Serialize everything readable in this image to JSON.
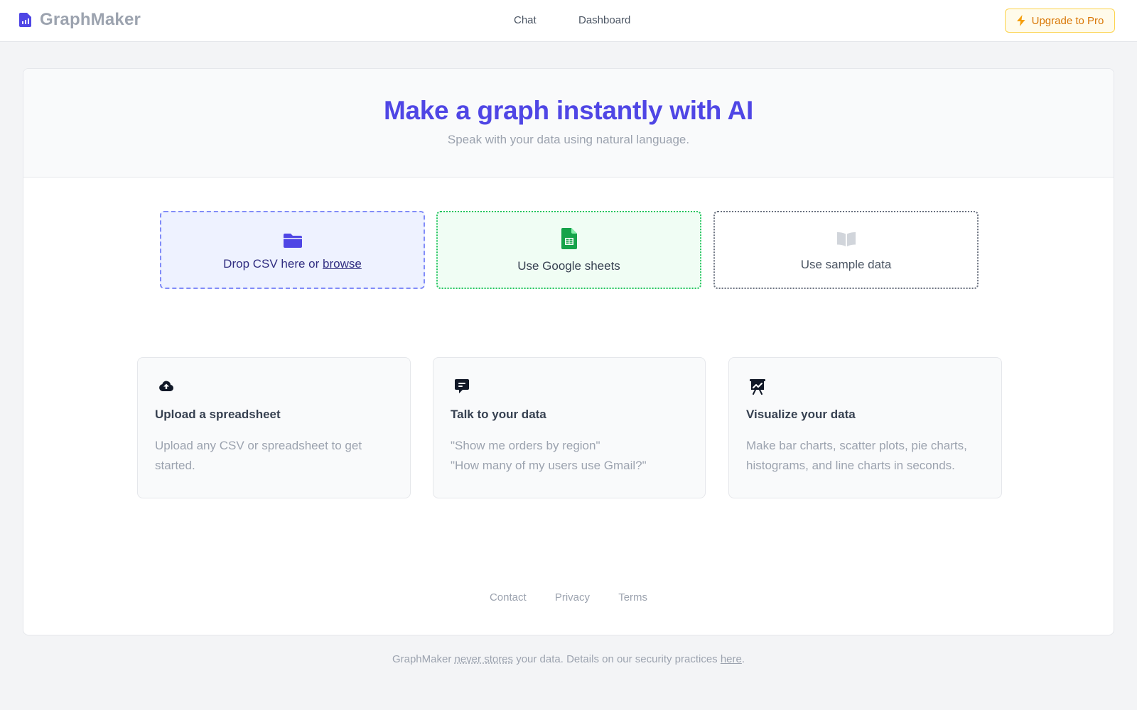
{
  "header": {
    "brand_name": "GraphMaker",
    "nav": [
      {
        "label": "Chat"
      },
      {
        "label": "Dashboard"
      }
    ],
    "upgrade_label": "Upgrade to Pro"
  },
  "hero": {
    "title": "Make a graph instantly with AI",
    "subtitle": "Speak with your data using natural language."
  },
  "options": {
    "csv": {
      "prefix": "Drop CSV here or ",
      "link": "browse",
      "icon": "folder-icon"
    },
    "sheets": {
      "label": "Use Google sheets",
      "icon": "google-sheets-icon"
    },
    "sample": {
      "label": "Use sample data",
      "icon": "book-icon"
    }
  },
  "features": [
    {
      "icon": "cloud-upload-icon",
      "title": "Upload a spreadsheet",
      "lines": [
        "Upload any CSV or spreadsheet to get started."
      ]
    },
    {
      "icon": "chat-bubble-icon",
      "title": "Talk to your data",
      "lines": [
        "\"Show me orders by region\"",
        "\"How many of my users use Gmail?\""
      ]
    },
    {
      "icon": "presentation-chart-icon",
      "title": "Visualize your data",
      "lines": [
        "Make bar charts, scatter plots, pie charts, histograms, and line charts in seconds."
      ]
    }
  ],
  "footer_links": [
    {
      "label": "Contact"
    },
    {
      "label": "Privacy"
    },
    {
      "label": "Terms"
    }
  ],
  "note": {
    "part1": "GraphMaker ",
    "link1": "never stores",
    "part2": " your data. Details on our security practices ",
    "link2": "here",
    "part3": "."
  },
  "colors": {
    "accent": "#4f46e5",
    "sheets_green": "#16a34a",
    "upgrade": "#d97706"
  }
}
